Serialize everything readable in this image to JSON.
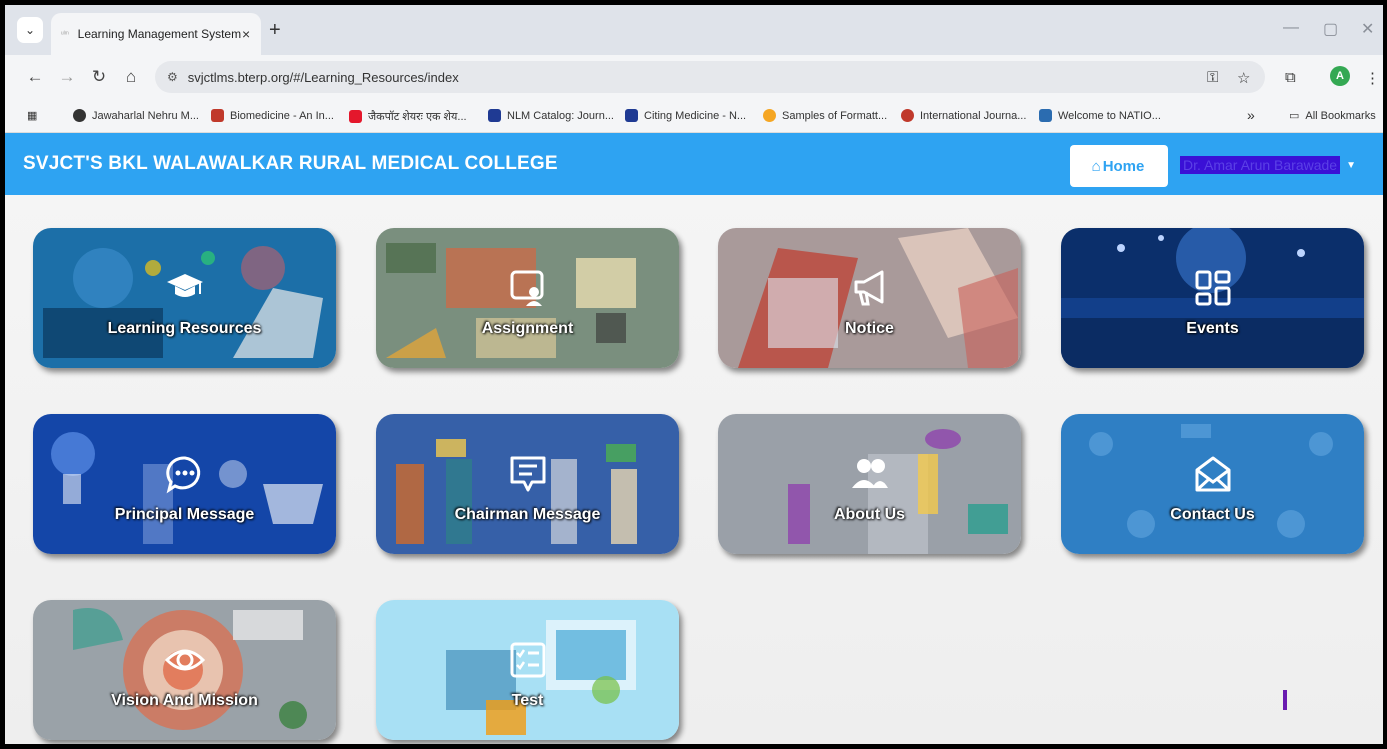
{
  "browser": {
    "tab_title": "Learning Management System",
    "tab_close": "×",
    "new_tab": "+",
    "url": "svjctlms.bterp.org/#/Learning_Resources/index",
    "profile_initial": "A",
    "bookmarks": [
      {
        "label": "Jawaharlal Nehru M...",
        "color": "#333333"
      },
      {
        "label": "Biomedicine - An In...",
        "color": "#c0392b"
      },
      {
        "label": "जैकपॉट शेयरः एक शेय...",
        "color": "#e4172c"
      },
      {
        "label": "NLM Catalog: Journ...",
        "color": "#1f3a93"
      },
      {
        "label": "Citing Medicine - N...",
        "color": "#1f3a93"
      },
      {
        "label": "Samples of Formatt...",
        "color": "#f5a623"
      },
      {
        "label": "International Journa...",
        "color": "#c0392b"
      },
      {
        "label": "Welcome to NATIO...",
        "color": "#2b6cb0"
      }
    ],
    "more_bookmarks": "»",
    "all_bookmarks": "All Bookmarks"
  },
  "header": {
    "brand": "SVJCT'S BKL WALAWALKAR RURAL MEDICAL COLLEGE",
    "home_label": "Home",
    "user_name": "Dr. Amar Arun Barawade",
    "accent": "#2ea3f2"
  },
  "cards": [
    {
      "label": "Learning Resources",
      "icon": "graduation-cap-icon"
    },
    {
      "label": "Assignment",
      "icon": "presentation-user-icon"
    },
    {
      "label": "Notice",
      "icon": "megaphone-icon"
    },
    {
      "label": "Events",
      "icon": "dashboard-grid-icon"
    },
    {
      "label": "Principal Message",
      "icon": "chat-bubble-icon"
    },
    {
      "label": "Chairman Message",
      "icon": "message-text-icon"
    },
    {
      "label": "About Us",
      "icon": "users-icon"
    },
    {
      "label": "Contact Us",
      "icon": "envelope-icon"
    },
    {
      "label": "Vision And Mission",
      "icon": "eye-icon"
    },
    {
      "label": "Test",
      "icon": "checklist-icon"
    }
  ]
}
